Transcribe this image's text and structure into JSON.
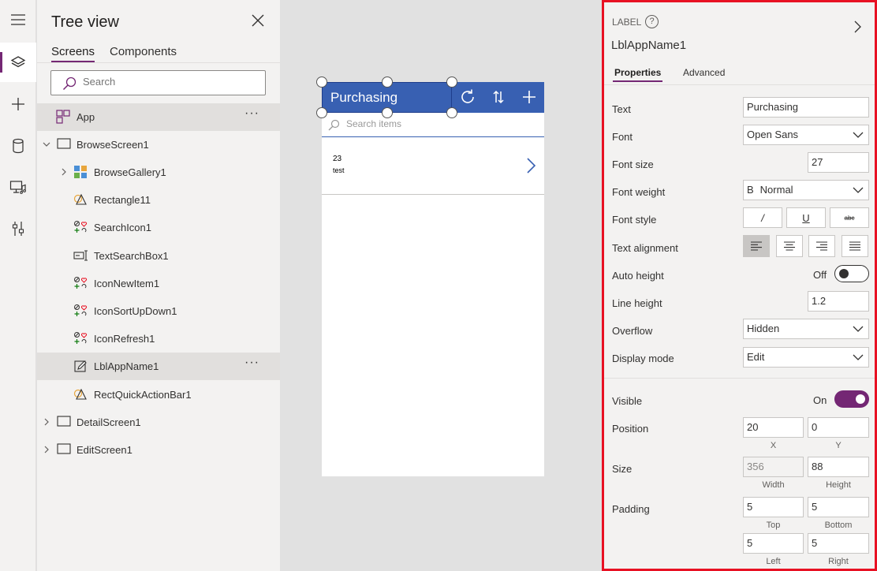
{
  "tree": {
    "title": "Tree view",
    "tabs": [
      "Screens",
      "Components"
    ],
    "search_placeholder": "Search",
    "items": [
      {
        "label": "App",
        "icon": "app-icon"
      },
      {
        "label": "BrowseScreen1",
        "icon": "screen-icon"
      },
      {
        "label": "BrowseGallery1",
        "icon": "gallery-icon"
      },
      {
        "label": "Rectangle11",
        "icon": "shape-icon"
      },
      {
        "label": "SearchIcon1",
        "icon": "icons-control-icon"
      },
      {
        "label": "TextSearchBox1",
        "icon": "text-input-icon"
      },
      {
        "label": "IconNewItem1",
        "icon": "icons-control-icon"
      },
      {
        "label": "IconSortUpDown1",
        "icon": "icons-control-icon"
      },
      {
        "label": "IconRefresh1",
        "icon": "icons-control-icon"
      },
      {
        "label": "LblAppName1",
        "icon": "label-edit-icon"
      },
      {
        "label": "RectQuickActionBar1",
        "icon": "shape-icon"
      },
      {
        "label": "DetailScreen1",
        "icon": "screen-icon"
      },
      {
        "label": "EditScreen1",
        "icon": "screen-icon"
      }
    ],
    "more_label": "···"
  },
  "canvas": {
    "app_title": "Purchasing",
    "search_placeholder": "Search items",
    "gallery_item": {
      "title": "23",
      "subtitle": "test"
    },
    "header_colour": "#3860b2"
  },
  "properties": {
    "kind": "LABEL",
    "help": "?",
    "control_name": "LblAppName1",
    "tabs": [
      "Properties",
      "Advanced"
    ],
    "text_label": "Text",
    "text_value": "Purchasing",
    "font_label": "Font",
    "font_value": "Open Sans",
    "font_size_label": "Font size",
    "font_size_value": "27",
    "font_weight_label": "Font weight",
    "font_weight_prefix": "B",
    "font_weight_value": "Normal",
    "font_style_label": "Font style",
    "font_style_buttons": [
      "/",
      "U",
      "abc"
    ],
    "text_alignment_label": "Text alignment",
    "auto_height_label": "Auto height",
    "auto_height_state": "Off",
    "line_height_label": "Line height",
    "line_height_value": "1.2",
    "overflow_label": "Overflow",
    "overflow_value": "Hidden",
    "display_mode_label": "Display mode",
    "display_mode_value": "Edit",
    "visible_label": "Visible",
    "visible_state": "On",
    "position_label": "Position",
    "position_x": "20",
    "position_y": "0",
    "x_caption": "X",
    "y_caption": "Y",
    "size_label": "Size",
    "width_value": "356",
    "height_value": "88",
    "width_caption": "Width",
    "height_caption": "Height",
    "padding_label": "Padding",
    "padding_top": "5",
    "padding_bottom": "5",
    "padding_left": "5",
    "padding_right": "5",
    "top_caption": "Top",
    "bottom_caption": "Bottom",
    "left_caption": "Left",
    "right_caption": "Right",
    "accent_colour": "#742774",
    "highlight_border_colour": "#e81123"
  }
}
